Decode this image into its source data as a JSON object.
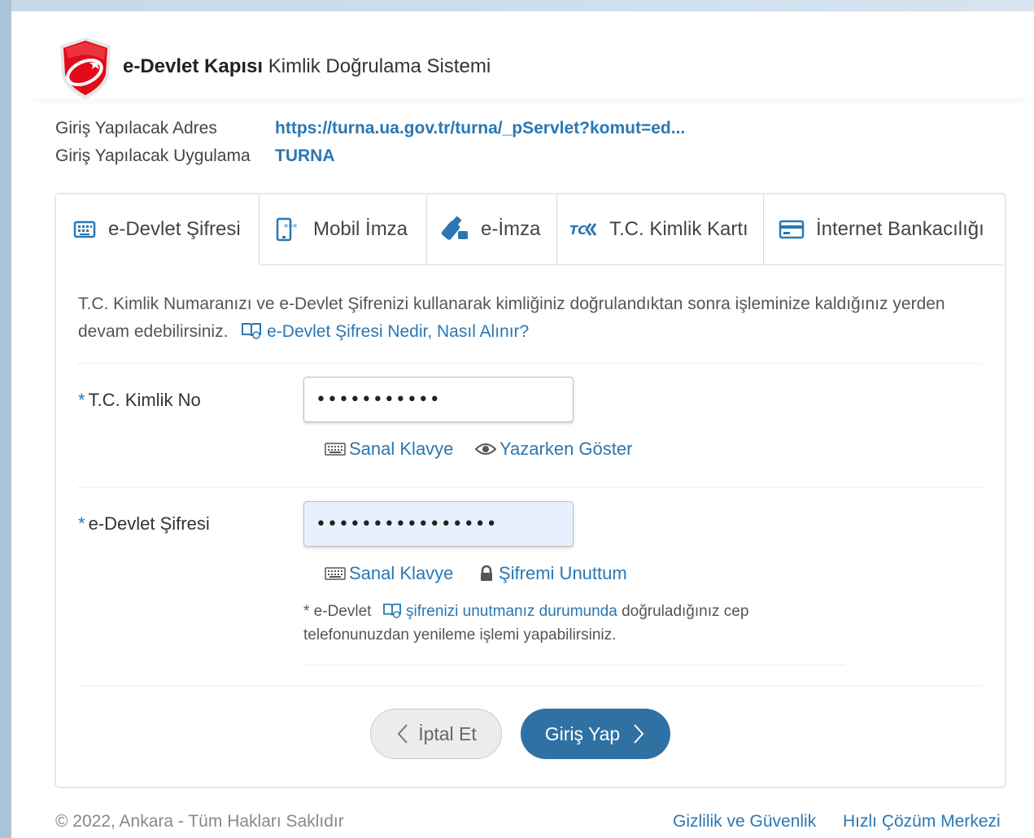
{
  "header": {
    "title_bold": "e-Devlet Kapısı",
    "title_rest": " Kimlik Doğrulama Sistemi"
  },
  "info": {
    "address_label": "Giriş Yapılacak Adres",
    "address_value": "https://turna.ua.gov.tr/turna/_pServlet?komut=ed...",
    "app_label": "Giriş Yapılacak Uygulama",
    "app_value": "TURNA"
  },
  "tabs": [
    {
      "label": "e-Devlet Şifresi",
      "icon": "keyboard-icon",
      "active": true
    },
    {
      "label": "Mobil İmza",
      "icon": "mobile-signature-icon",
      "active": false
    },
    {
      "label": "e-İmza",
      "icon": "usb-token-icon",
      "active": false
    },
    {
      "label": "T.C. Kimlik Kartı",
      "icon": "id-card-logo-icon",
      "active": false
    },
    {
      "label": "İnternet Bankacılığı",
      "icon": "credit-card-icon",
      "active": false
    }
  ],
  "description": {
    "text": "T.C. Kimlik Numaranızı ve e-Devlet Şifrenizi kullanarak kimliğiniz doğrulandıktan sonra işleminize kaldığınız yerden devam edebilirsiniz.",
    "link": "e-Devlet Şifresi Nedir, Nasıl Alınır?"
  },
  "form": {
    "tc_label": "T.C. Kimlik No",
    "tc_value": "•••••••••••",
    "password_label": "e-Devlet Şifresi",
    "password_value": "••••••••••••••••",
    "required_mark": "*",
    "virtual_keyboard": "Sanal Klavye",
    "show_while_typing": "Yazarken Göster",
    "forgot_password": "Şifremi Unuttum",
    "note_prefix": "* e-Devlet",
    "note_link": "şifrenizi unutmanız durumunda",
    "note_suffix": "doğruladığınız cep telefonunuzdan yenileme işlemi yapabilirsiniz."
  },
  "buttons": {
    "cancel": "İptal Et",
    "login": "Giriş Yap"
  },
  "footer": {
    "copyright": "© 2022, Ankara - Tüm Hakları Saklıdır",
    "privacy": "Gizlilik ve Güvenlik",
    "support": "Hızlı Çözüm Merkezi"
  },
  "colors": {
    "accent": "#2a77b3",
    "button": "#2f71a3",
    "logo_red": "#e30a17"
  }
}
